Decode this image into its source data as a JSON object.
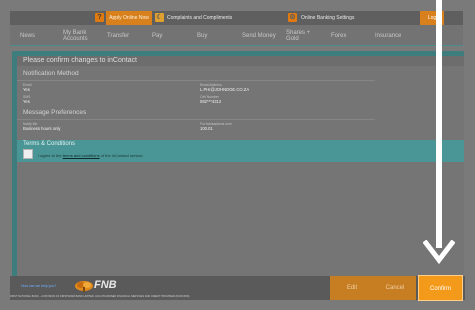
{
  "topbar": {
    "help_icon": "?",
    "apply_label": "Apply Online Now",
    "complaints_label": "Complaints and Compliments",
    "settings_label": "Online Banking Settings",
    "logout_label": "Log"
  },
  "nav": {
    "items": [
      "News",
      "My Bank\nAccounts",
      "Transfer",
      "Pay",
      "Buy",
      "Send Money",
      "Shares +\nGold",
      "Forex",
      "Insurance"
    ]
  },
  "modal": {
    "title": "Please confirm changes to inContact",
    "notification": {
      "title": "Notification Method",
      "email_label": "Email",
      "email_value": "Yes",
      "email_address_label": "Email Address",
      "email_address_value": "L.PHI@JOHNDOE.CO.ZA",
      "sms_label": "SMS",
      "sms_value": "Yes",
      "cell_label": "Cell Number",
      "cell_value": "082***4312"
    },
    "preferences": {
      "title": "Message Preferences",
      "time_label": "Notify Me",
      "time_value": "Business hours only",
      "amount_label": "For transactions over",
      "amount_value": "100.01"
    },
    "terms": {
      "title": "Terms & Conditions",
      "agree_prefix": "I agree to the ",
      "agree_link": "terms and conditions",
      "agree_suffix": " of the inContact service."
    }
  },
  "footer": {
    "link": "How can we help you?",
    "brand": "FNB",
    "legal": "FIRST NATIONAL BANK – A DIVISION OF FIRSTRAND BANK LIMITED. AN AUTHORISED FINANCIAL SERVICES AND CREDIT PROVIDER (NCRCP20).",
    "edit_label": "Edit",
    "cancel_label": "Cancel",
    "confirm_label": "Confirm"
  },
  "colors": {
    "accent_orange": "#f39a1a",
    "teal": "#4a9595"
  }
}
